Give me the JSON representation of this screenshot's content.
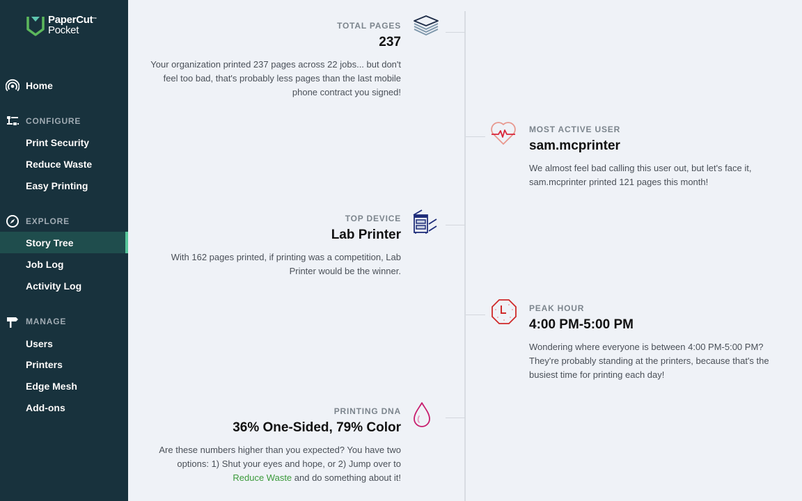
{
  "app": {
    "brand_line1": "PaperCut",
    "brand_tm": "™",
    "brand_line2": "Pocket",
    "accent_color": "#56c59a",
    "sidebar_color": "#18323d"
  },
  "sidebar": {
    "home": {
      "label": "Home",
      "icon": "broadcast-icon"
    },
    "sections": [
      {
        "title": "CONFIGURE",
        "icon": "sliders-icon",
        "items": [
          {
            "label": "Print Security"
          },
          {
            "label": "Reduce Waste"
          },
          {
            "label": "Easy Printing"
          }
        ]
      },
      {
        "title": "EXPLORE",
        "icon": "compass-icon",
        "items": [
          {
            "label": "Story Tree",
            "active": true
          },
          {
            "label": "Job Log"
          },
          {
            "label": "Activity Log"
          }
        ]
      },
      {
        "title": "MANAGE",
        "icon": "signpost-icon",
        "items": [
          {
            "label": "Users"
          },
          {
            "label": "Printers"
          },
          {
            "label": "Edge Mesh"
          },
          {
            "label": "Add-ons"
          }
        ]
      }
    ]
  },
  "story": [
    {
      "label": "TOTAL PAGES",
      "title": "237",
      "body": "Your organization printed 237 pages across 22 jobs... but don't feel too bad, that's probably less pages than the last mobile phone contract you signed!",
      "icon": "stack-icon"
    },
    {
      "label": "MOST ACTIVE USER",
      "title": "sam.mcprinter",
      "body": "We almost feel bad calling this user out, but let's face it, sam.mcprinter printed 121 pages this month!",
      "icon": "heartbeat-icon"
    },
    {
      "label": "TOP DEVICE",
      "title": "Lab Printer",
      "body": "With 162 pages printed, if printing was a competition, Lab Printer would be the winner.",
      "icon": "printer-icon"
    },
    {
      "label": "PEAK HOUR",
      "title": "4:00 PM-5:00 PM",
      "body": "Wondering where everyone is between 4:00 PM-5:00 PM? They're probably standing at the printers, because that's the busiest time for printing each day!",
      "icon": "clock-icon"
    },
    {
      "label": "PRINTING DNA",
      "title": "36% One-Sided, 79% Color",
      "body_pre": "Are these numbers higher than you expected? You have two options: 1) Shut your eyes and hope, or 2) Jump over to ",
      "body_link": "Reduce Waste",
      "body_post": " and do something about it!",
      "icon": "droplet-icon"
    }
  ]
}
